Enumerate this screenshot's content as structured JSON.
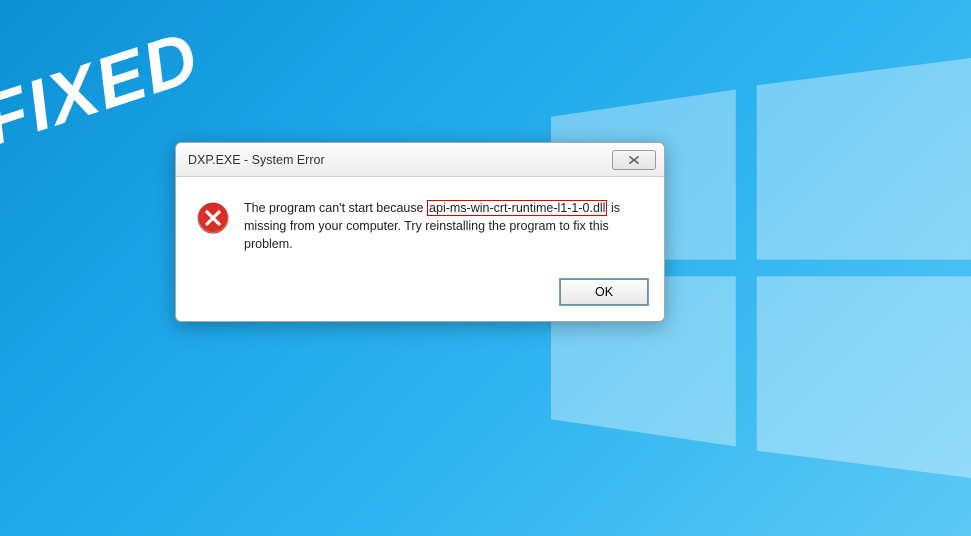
{
  "overlay": {
    "fixed_label": "FIXED"
  },
  "dialog": {
    "title": "DXP.EXE - System Error",
    "message_part1": "The program can't start because ",
    "highlighted_dll": "api-ms-win-crt-runtime-l1-1-0.dll",
    "message_part2": " is missing from your computer. Try reinstalling the program to fix this problem.",
    "ok_label": "OK"
  }
}
